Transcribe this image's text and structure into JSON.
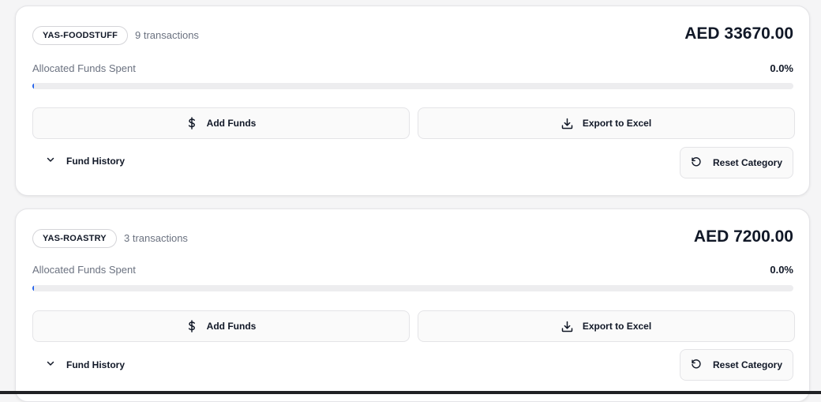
{
  "categories": [
    {
      "tag": "YAS-FOODSTUFF",
      "transactions": "9 transactions",
      "amount": "AED 33670.00",
      "spent_label": "Allocated Funds Spent",
      "spent_percent_label": "0.0%",
      "spent_fraction": 0.0,
      "add_funds_label": "Add Funds",
      "export_label": "Export to Excel",
      "history_label": "Fund History",
      "reset_label": "Reset Category"
    },
    {
      "tag": "YAS-ROASTRY",
      "transactions": "3 transactions",
      "amount": "AED 7200.00",
      "spent_label": "Allocated Funds Spent",
      "spent_percent_label": "0.0%",
      "spent_fraction": 0.0,
      "add_funds_label": "Add Funds",
      "export_label": "Export to Excel",
      "history_label": "Fund History",
      "reset_label": "Reset Category"
    }
  ],
  "icons": {
    "add_funds": "dollar-icon",
    "export": "download-icon",
    "history": "chevron-down-icon",
    "reset": "reset-icon"
  },
  "colors": {
    "progress_fill": "#2563eb",
    "progress_track": "#ededef",
    "text_muted": "#6b7280"
  }
}
